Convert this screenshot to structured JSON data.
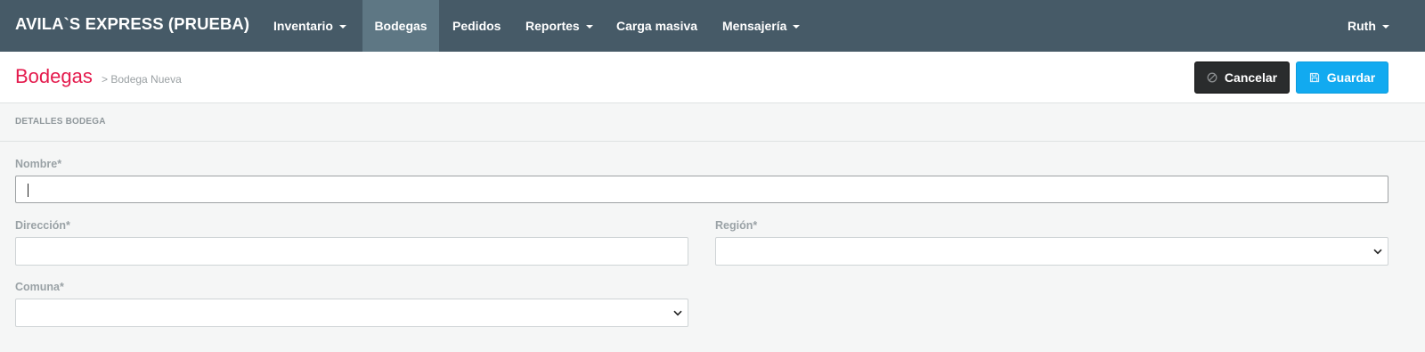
{
  "navbar": {
    "brand": "AVILA`S EXPRESS (PRUEBA)",
    "items": [
      {
        "label": "Inventario",
        "dropdown": true,
        "active": false
      },
      {
        "label": "Bodegas",
        "dropdown": false,
        "active": true
      },
      {
        "label": "Pedidos",
        "dropdown": false,
        "active": false
      },
      {
        "label": "Reportes",
        "dropdown": true,
        "active": false
      },
      {
        "label": "Carga masiva",
        "dropdown": false,
        "active": false
      },
      {
        "label": "Mensajería",
        "dropdown": true,
        "active": false
      }
    ],
    "user": "Ruth"
  },
  "header": {
    "title": "Bodegas",
    "breadcrumb": "> Bodega Nueva",
    "cancel_label": "Cancelar",
    "save_label": "Guardar",
    "cancel_icon": "ban-icon",
    "save_icon": "floppy-disk-icon"
  },
  "section": {
    "title": "DETALLES BODEGA"
  },
  "form": {
    "nombre_label": "Nombre*",
    "nombre_value": "",
    "direccion_label": "Dirección*",
    "direccion_value": "",
    "region_label": "Región*",
    "region_value": "",
    "comuna_label": "Comuna*",
    "comuna_value": ""
  },
  "colors": {
    "navbar": "#465a67",
    "nav_active": "#5e7784",
    "title": "#e41b4d",
    "cancel_button": "#2a2c2d",
    "save_button": "#12aaf0"
  }
}
